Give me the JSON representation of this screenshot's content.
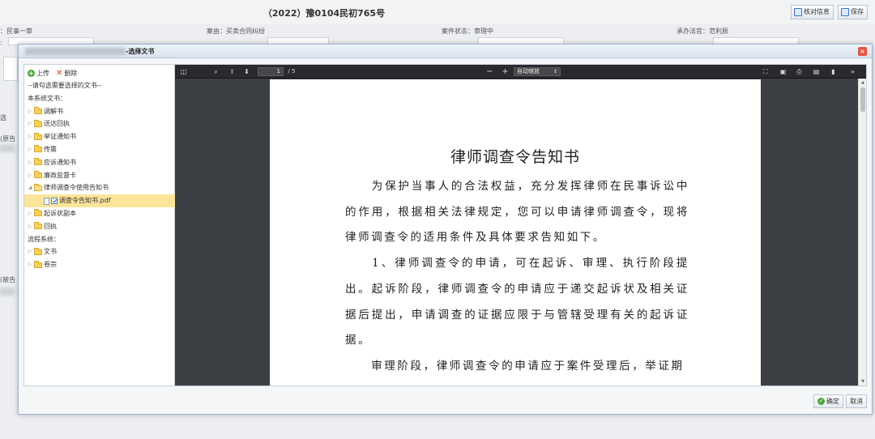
{
  "page": {
    "case_title": "（2022）豫0104民初765号",
    "btn_check_info": "核对信息",
    "btn_save": "保存",
    "info_procedure": "：民事一审",
    "info_cause": "案由：买卖合同纠纷",
    "info_status": "案件状态：审理中",
    "info_judge": "承办法官：范利辰",
    "side_label_1": "选",
    "side_label_2": "(原告",
    "side_label_3": "(被告",
    "side_label_4": ":"
  },
  "dialog": {
    "title": "-选择文书",
    "close": "×",
    "toolbar": {
      "upload": "上传",
      "delete": "删除"
    },
    "tree": {
      "hint": "--请勾选需要选择的文书--",
      "system_docs_label": "本系统文书：",
      "folders": [
        {
          "label": "调解书",
          "arrow": "▷"
        },
        {
          "label": "送达回执",
          "arrow": "▷"
        },
        {
          "label": "举证通知书",
          "arrow": "▷"
        },
        {
          "label": "传票",
          "arrow": "▷"
        },
        {
          "label": "应诉通知书",
          "arrow": "▷"
        },
        {
          "label": "廉政监督卡",
          "arrow": "▷"
        },
        {
          "label": "律师调查令使用告知书",
          "arrow": "◢"
        }
      ],
      "selected_file": "调查令告知书.pdf",
      "folders_after": [
        {
          "label": "起诉状副本",
          "arrow": "▷"
        },
        {
          "label": "回执",
          "arrow": "▷"
        }
      ],
      "flow_system_label": "流程系统：",
      "flow_folders": [
        {
          "label": "文书",
          "arrow": "▷"
        },
        {
          "label": "卷宗",
          "arrow": "▷"
        }
      ]
    },
    "viewer": {
      "page_current": "1",
      "page_total": "/ 5",
      "zoom": "自动缩放",
      "zoom_out": "−",
      "zoom_in": "+",
      "doc_title": "律师调查令告知书",
      "paragraphs": [
        "　　为保护当事人的合法权益，充分发挥律师在民事诉讼中的作用，根据相关法律规定，您可以申请律师调查令，现将律师调查令的适用条件及具体要求告知如下。",
        "　　1、律师调查令的申请，可在起诉、审理、执行阶段提出。",
        "　　起诉阶段，律师调查令的申请应于递交起诉状及相关证据后提出，申请调查的证据应限于与管辖受理有关的起诉证据。",
        "　　审理阶段，律师调查令的申请应于案件受理后，举证期"
      ]
    },
    "footer": {
      "confirm": "确定",
      "cancel": "取消"
    }
  }
}
